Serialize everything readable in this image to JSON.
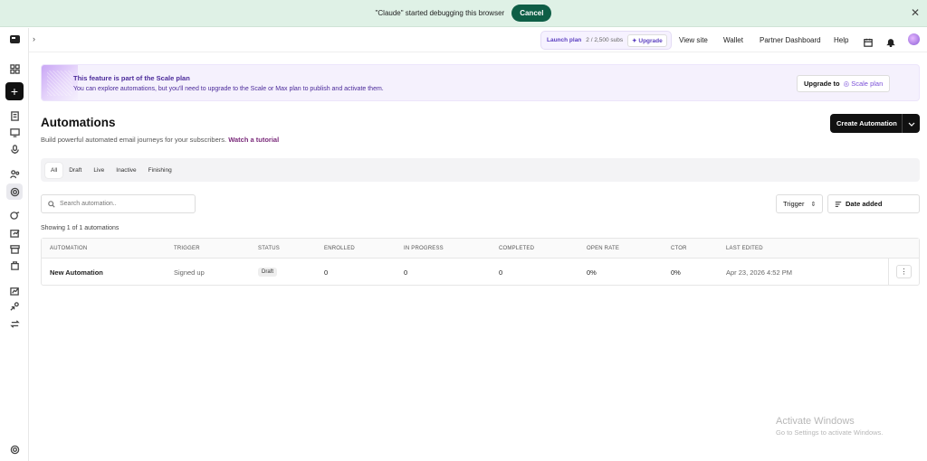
{
  "debug_bar": {
    "message": "\"Claude\" started debugging this browser",
    "cancel_label": "Cancel",
    "close_glyph": "✕"
  },
  "topbar": {
    "plan_name": "Launch plan",
    "plan_usage": "2 / 2,500 subs",
    "plan_upgrade": "✦ Upgrade",
    "links": [
      "View site",
      "Wallet",
      "Partner Dashboard",
      "Help"
    ]
  },
  "banner": {
    "title": "This feature is part of the Scale plan",
    "subtitle": "You can explore automations, but you'll need to upgrade to the Scale or Max plan to publish and activate them.",
    "button_prefix": "Upgrade to",
    "button_plan": "◎ Scale plan"
  },
  "page": {
    "title": "Automations",
    "subtitle": "Build powerful automated email journeys for your subscribers.",
    "tutorial_link": "Watch a tutorial",
    "create_label": "Create Automation"
  },
  "tabs": [
    "All",
    "Draft",
    "Live",
    "Inactive",
    "Finishing"
  ],
  "filters": {
    "search_placeholder": "Search automation..",
    "trigger_label": "Trigger",
    "sort_label": "Date added"
  },
  "showing": "Showing 1 of 1 automations",
  "table": {
    "columns": [
      "AUTOMATION",
      "TRIGGER",
      "STATUS",
      "ENROLLED",
      "IN PROGRESS",
      "COMPLETED",
      "OPEN RATE",
      "CTOR",
      "LAST EDITED"
    ],
    "rows": [
      {
        "name": "New Automation",
        "trigger": "Signed up",
        "status": "Draft",
        "enrolled": "0",
        "in_progress": "0",
        "completed": "0",
        "open_rate": "0%",
        "ctor": "0%",
        "last_edited": "Apr 23, 2026 4:52 PM"
      }
    ]
  },
  "watermark": {
    "title": "Activate Windows",
    "subtitle": "Go to Settings to activate Windows."
  },
  "colors": {
    "primary": "#111111",
    "accent_purple": "#7a4fd8",
    "banner_bg": "#f5f1fd",
    "debug_bar_bg": "#dff1e6",
    "cancel_bg": "#0e5e46"
  }
}
